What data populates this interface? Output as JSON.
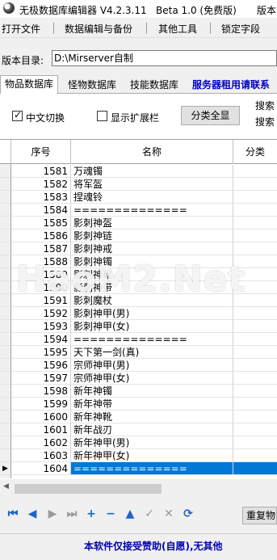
{
  "window": {
    "title": "无极数据库编辑器 V4.2.3.11",
    "beta": "Beta 1.0 (免费版)",
    "right_text": "版本"
  },
  "menu": [
    "打开文件",
    "数据编辑与备份",
    "其他工具",
    "锁定字段"
  ],
  "version_dir": {
    "label": "版本目录:",
    "value": "D:\\Mirserver自制"
  },
  "tabs": [
    "物品数据库",
    "怪物数据库",
    "技能数据库"
  ],
  "tab_link": "服务器租用请联系",
  "options": {
    "chinese_switch": {
      "label": "中文切换",
      "checked": true
    },
    "show_ext": {
      "label": "显示扩展栏",
      "checked": false
    },
    "category_button": "分类全显",
    "search1": "搜索",
    "search2": "搜索"
  },
  "grid": {
    "columns": [
      "序号",
      "名称",
      "分类"
    ],
    "rows": [
      {
        "id": "1581",
        "name": "万魂镯"
      },
      {
        "id": "1582",
        "name": "将军盔"
      },
      {
        "id": "1583",
        "name": "捏魂铃"
      },
      {
        "id": "1584",
        "name": "=============="
      },
      {
        "id": "1585",
        "name": "影刺神盔"
      },
      {
        "id": "1586",
        "name": "影刺神链"
      },
      {
        "id": "1587",
        "name": "影刺神戒"
      },
      {
        "id": "1588",
        "name": "影刺神镯"
      },
      {
        "id": "1589",
        "name": "影刺神靴"
      },
      {
        "id": "1590",
        "name": "影刺神带"
      },
      {
        "id": "1591",
        "name": "影刺魔杖"
      },
      {
        "id": "1592",
        "name": "影刺神甲(男)"
      },
      {
        "id": "1593",
        "name": "影刺神甲(女)"
      },
      {
        "id": "1594",
        "name": "=============="
      },
      {
        "id": "1595",
        "name": "天下第一剑(真)"
      },
      {
        "id": "1596",
        "name": "宗师神甲(男)"
      },
      {
        "id": "1597",
        "name": "宗师神甲(女)"
      },
      {
        "id": "1598",
        "name": "新年神镯"
      },
      {
        "id": "1599",
        "name": "新年神带"
      },
      {
        "id": "1600",
        "name": "新年神靴"
      },
      {
        "id": "1601",
        "name": "新年战刃"
      },
      {
        "id": "1602",
        "name": "新年神甲(男)"
      },
      {
        "id": "1603",
        "name": "新年神甲(女)"
      },
      {
        "id": "1604",
        "name": "=============="
      }
    ]
  },
  "nav_icons": [
    "first-icon",
    "prior-icon",
    "next-icon",
    "last-icon",
    "insert-icon",
    "delete-icon",
    "edit-icon",
    "post-icon",
    "cancel-icon",
    "refresh-icon"
  ],
  "reset_button": "重复物",
  "footer": "本软件仅接受赞助(自愿),无其他",
  "watermark": "HaoM2.Net",
  "colors": {
    "selection": "#0078d7",
    "link": "#0000c8"
  }
}
